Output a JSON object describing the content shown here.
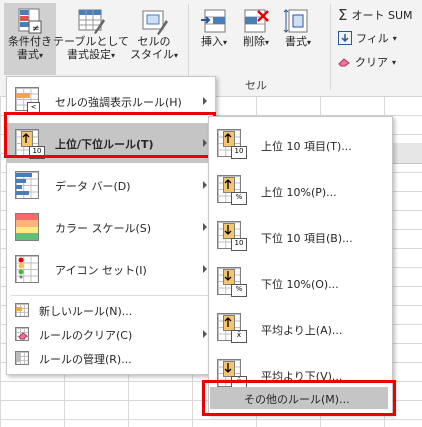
{
  "ribbon": {
    "conditional_format": {
      "line1": "条件付き",
      "line2": "書式",
      "arrow": "▾"
    },
    "format_as_table": {
      "line1": "テーブルとして",
      "line2": "書式設定",
      "arrow": "▾"
    },
    "cell_style": {
      "line1": "セルの",
      "line2": "スタイル",
      "arrow": "▾"
    },
    "insert": {
      "label": "挿入",
      "arrow": "▾"
    },
    "delete": {
      "label": "削除",
      "arrow": "▾"
    },
    "format": {
      "label": "書式",
      "arrow": "▾"
    },
    "cells_group_label": "セル",
    "autosum": {
      "icon": "Σ",
      "label": "オート SUM"
    },
    "fill": {
      "label": "フィル",
      "arrow": "▾"
    },
    "clear": {
      "label": "クリア",
      "arrow": "▾"
    }
  },
  "main_menu": {
    "items": [
      {
        "label": "セルの強調表示ルール(H)",
        "icon": "highlight-rules-icon"
      },
      {
        "label": "上位/下位ルール(T)",
        "icon": "top-bottom-rules-icon",
        "highlighted": true
      },
      {
        "label": "データ バー(D)",
        "icon": "data-bars-icon"
      },
      {
        "label": "カラー スケール(S)",
        "icon": "color-scales-icon"
      },
      {
        "label": "アイコン セット(I)",
        "icon": "icon-sets-icon"
      }
    ],
    "small_items": [
      {
        "label": "新しいルール(N)...",
        "icon": "new-rule-icon"
      },
      {
        "label": "ルールのクリア(C)",
        "icon": "clear-rules-icon"
      },
      {
        "label": "ルールの管理(R)...",
        "icon": "manage-rules-icon"
      }
    ]
  },
  "submenu": {
    "items": [
      {
        "label": "上位 10 項目(T)...",
        "badge": "10"
      },
      {
        "label": "上位 10%(P)...",
        "badge": "%"
      },
      {
        "label": "下位 10 項目(B)...",
        "badge": "10"
      },
      {
        "label": "下位 10%(O)...",
        "badge": "%"
      },
      {
        "label": "平均より上(A)...",
        "badge": "x̄"
      },
      {
        "label": "平均より下(V)...",
        "badge": "x̄"
      }
    ],
    "more_rules": "その他のルール(M)..."
  },
  "colors": {
    "accent_red": "#e00000",
    "highlight_gray": "#c5c5c5"
  }
}
